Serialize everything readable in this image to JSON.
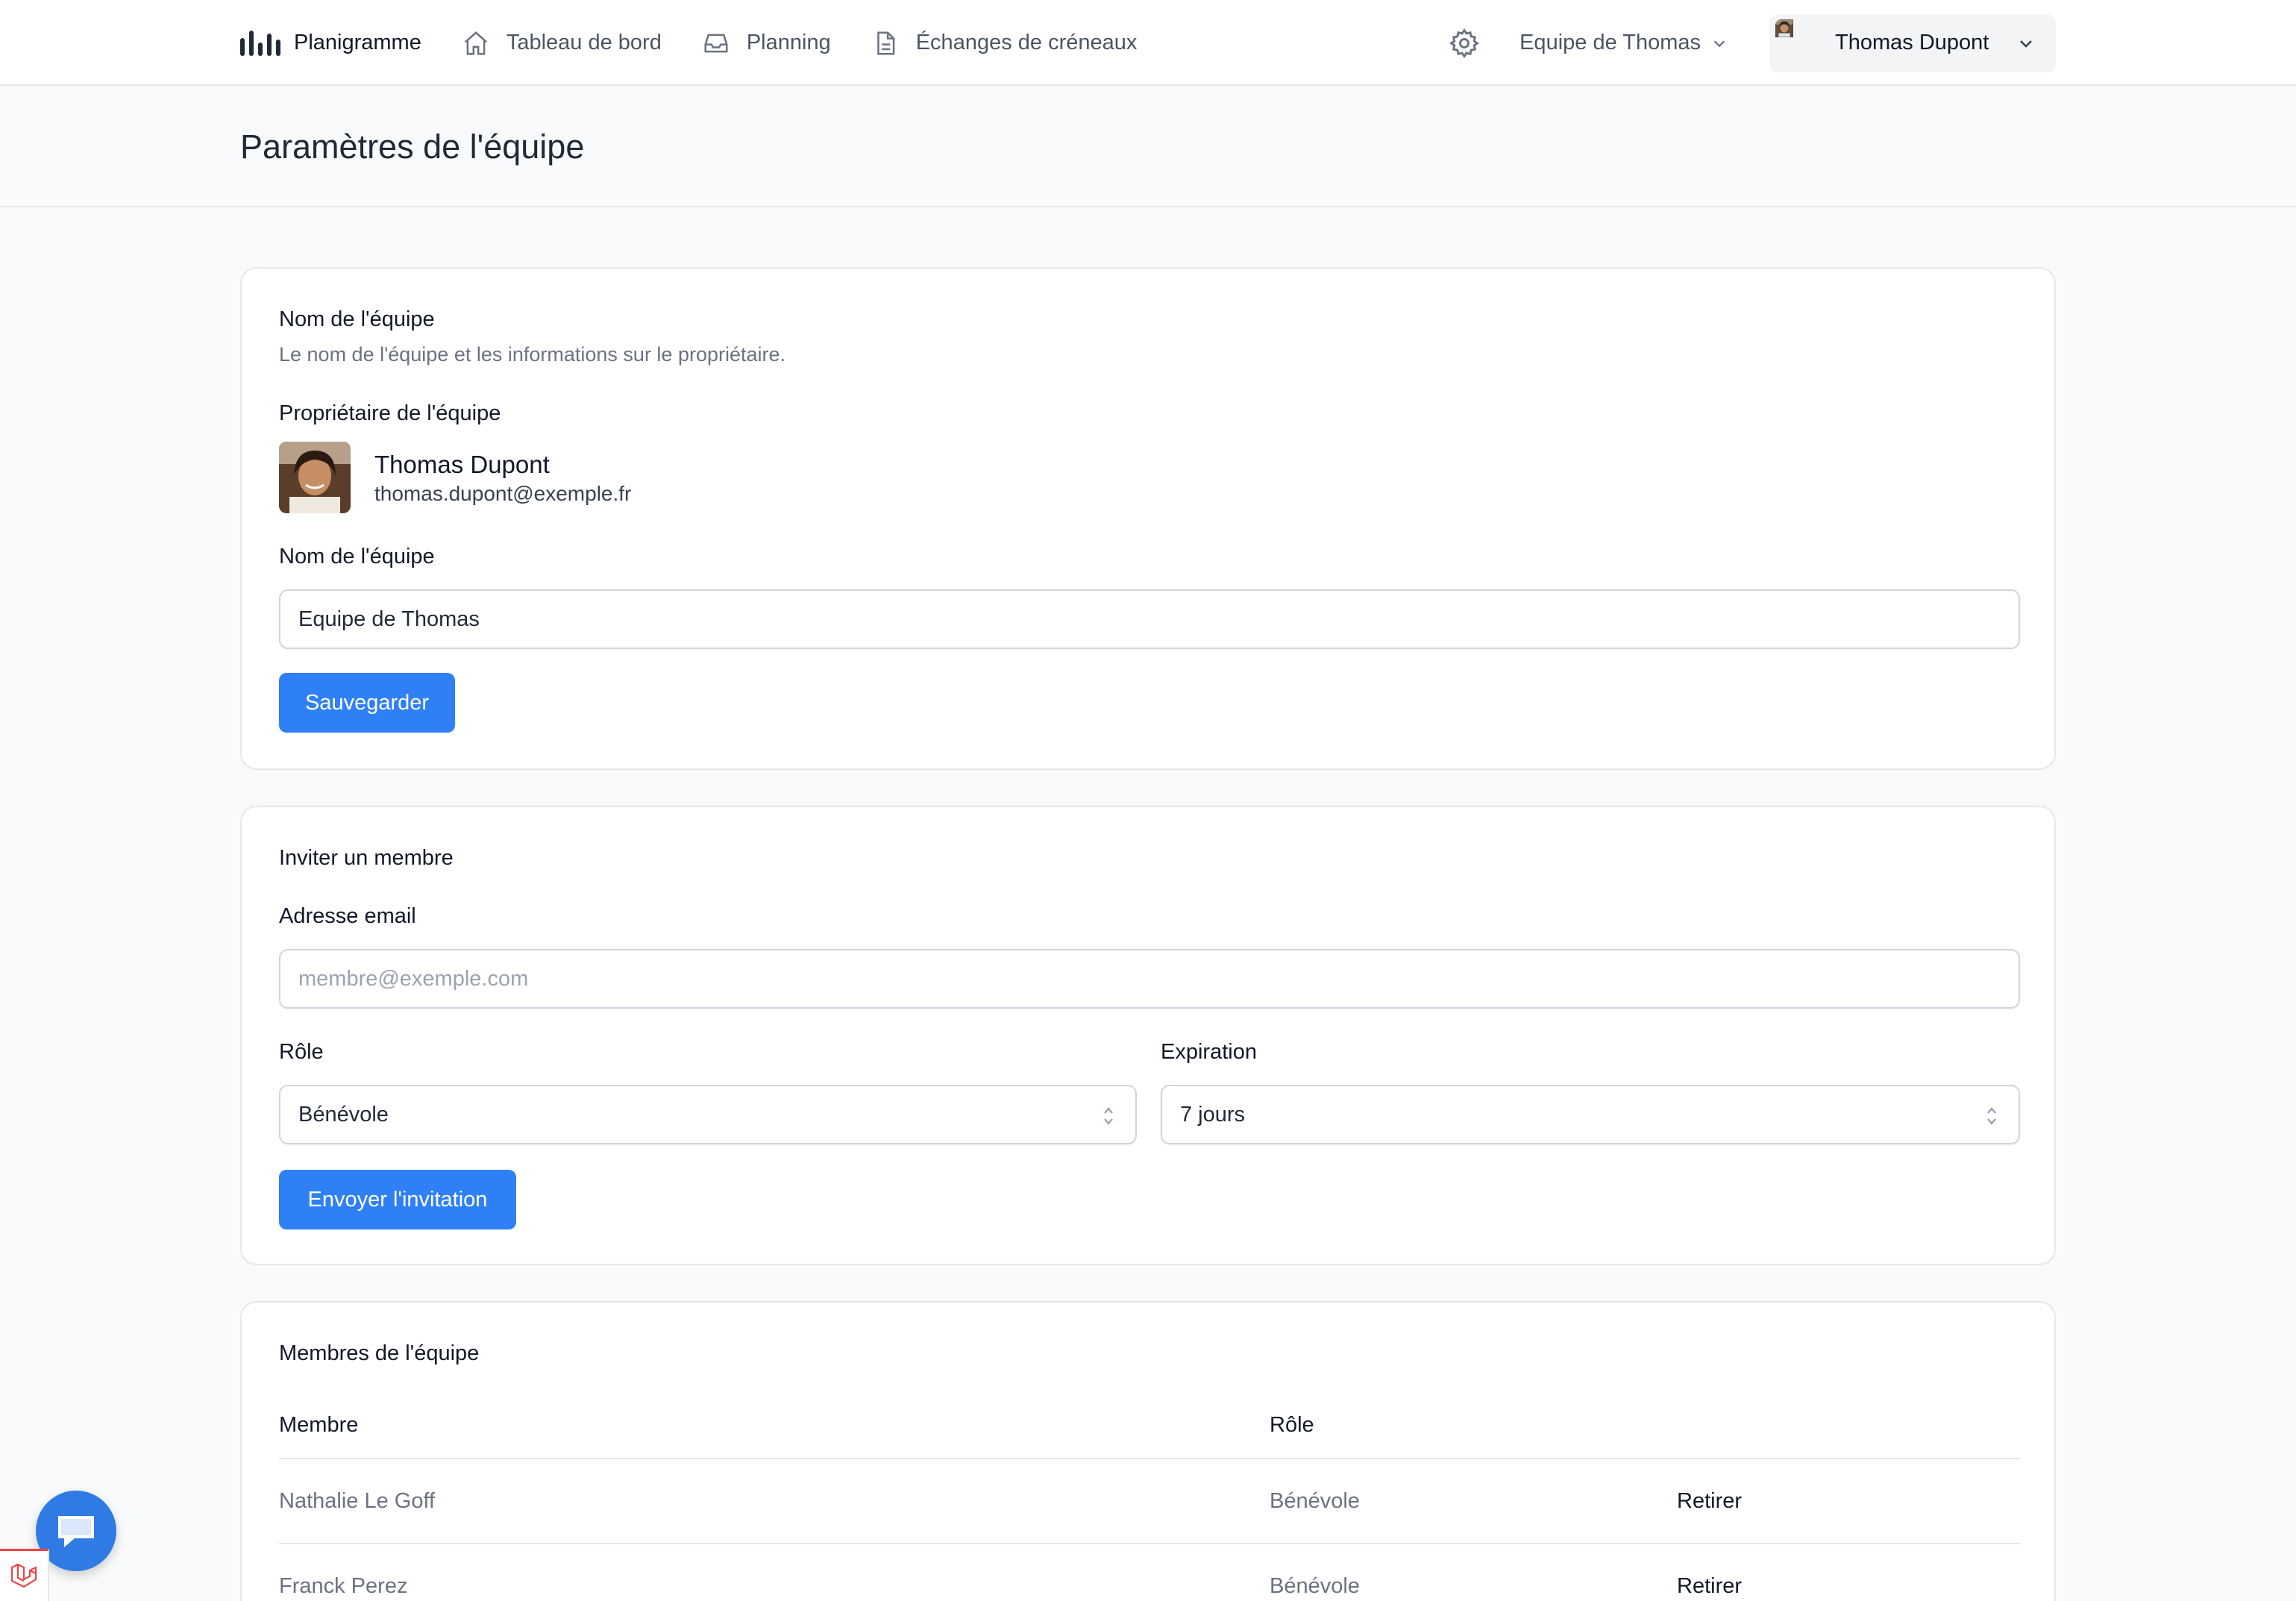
{
  "nav": {
    "brand": "Planigramme",
    "links": [
      {
        "label": "Tableau de bord",
        "icon": "home-icon"
      },
      {
        "label": "Planning",
        "icon": "inbox-icon"
      },
      {
        "label": "Échanges de créneaux",
        "icon": "document-icon"
      }
    ],
    "team_switcher": "Equipe de Thomas",
    "user_name": "Thomas Dupont"
  },
  "page_title": "Paramètres de l'équipe",
  "team_name_card": {
    "title": "Nom de l'équipe",
    "description": "Le nom de l'équipe et les informations sur le propriétaire.",
    "owner_label": "Propriétaire de l'équipe",
    "owner_name": "Thomas Dupont",
    "owner_email": "thomas.dupont@exemple.fr",
    "name_label": "Nom de l'équipe",
    "name_value": "Equipe de Thomas",
    "save_label": "Sauvegarder"
  },
  "invite_card": {
    "title": "Inviter un membre",
    "email_label": "Adresse email",
    "email_placeholder": "membre@exemple.com",
    "role_label": "Rôle",
    "role_value": "Bénévole",
    "expiration_label": "Expiration",
    "expiration_value": "7 jours",
    "send_label": "Envoyer l'invitation"
  },
  "members_card": {
    "title": "Membres de l'équipe",
    "columns": [
      "Membre",
      "Rôle"
    ],
    "rows": [
      {
        "name": "Nathalie Le Goff",
        "role": "Bénévole",
        "action": "Retirer"
      },
      {
        "name": "Franck Perez",
        "role": "Bénévole",
        "action": "Retirer"
      }
    ]
  },
  "colors": {
    "primary": "#2f80f7",
    "chat_button": "#2f7ae5",
    "badge_accent": "#ef4444"
  }
}
